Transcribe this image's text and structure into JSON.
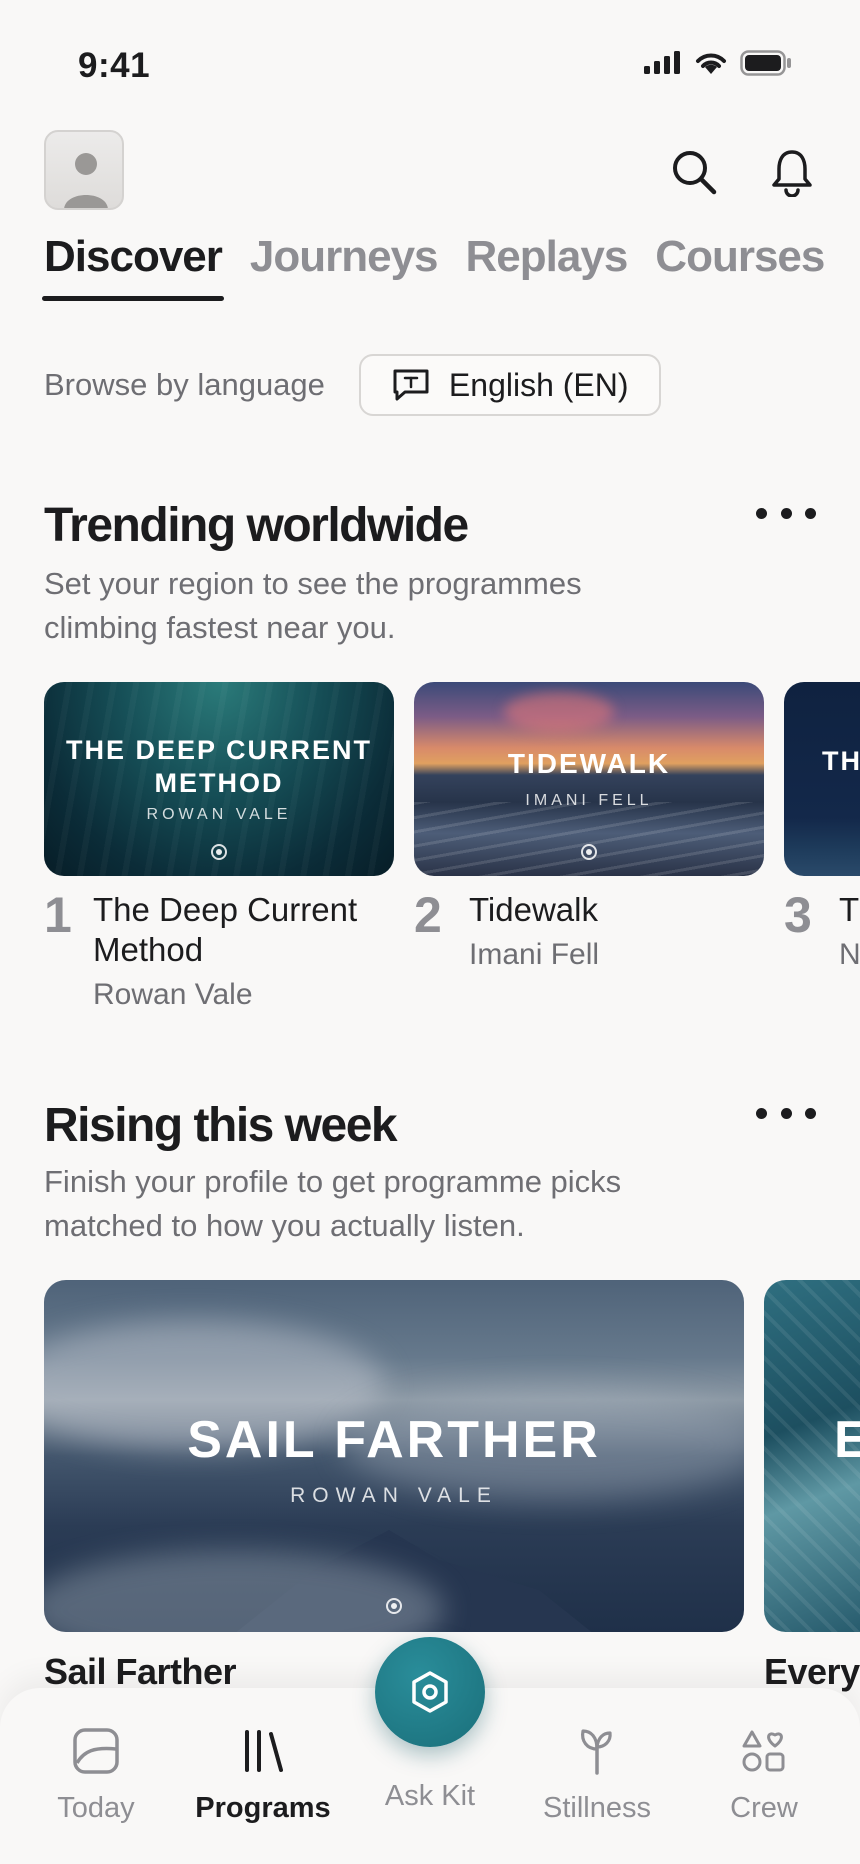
{
  "status_bar": {
    "time": "9:41"
  },
  "tabs": [
    {
      "label": "Discover",
      "active": true
    },
    {
      "label": "Journeys",
      "active": false
    },
    {
      "label": "Replays",
      "active": false
    },
    {
      "label": "Courses",
      "active": false
    }
  ],
  "language": {
    "label": "Browse by language",
    "selected": "English (EN)"
  },
  "trending": {
    "title": "Trending worldwide",
    "subtitle": "Set your region to see the programmes climbing fastest near you.",
    "items": [
      {
        "rank": "1",
        "title": "The Deep Current Method",
        "author": "Rowan Vale",
        "cover_title": "THE DEEP CURRENT METHOD",
        "cover_author": "ROWAN VALE"
      },
      {
        "rank": "2",
        "title": "Tidewalk",
        "author": "Imani Fell",
        "cover_title": "TIDEWALK",
        "cover_author": "IMANI FELL"
      },
      {
        "rank": "3",
        "title": "T",
        "author": "N",
        "cover_title": "TH"
      }
    ]
  },
  "rising": {
    "title": "Rising this week",
    "subtitle": "Finish your profile to get programme picks matched to how you actually listen.",
    "items": [
      {
        "title": "Sail Farther",
        "cover_title": "SAIL FARTHER",
        "cover_author": "ROWAN VALE"
      },
      {
        "title": "Every",
        "cover_title": "E"
      }
    ]
  },
  "bottom_nav": {
    "items": [
      {
        "label": "Today",
        "icon": "photo-icon",
        "active": false
      },
      {
        "label": "Programs",
        "icon": "library-icon",
        "active": true
      },
      {
        "label": "Ask Kit",
        "icon": "hexagon-icon",
        "active": false
      },
      {
        "label": "Stillness",
        "icon": "sprout-icon",
        "active": false
      },
      {
        "label": "Crew",
        "icon": "shapes-icon",
        "active": false
      }
    ]
  },
  "colors": {
    "accent": "#1f7d89",
    "text": "#1c1c1e",
    "muted": "#8e8e93",
    "background": "#f9f8f7"
  }
}
